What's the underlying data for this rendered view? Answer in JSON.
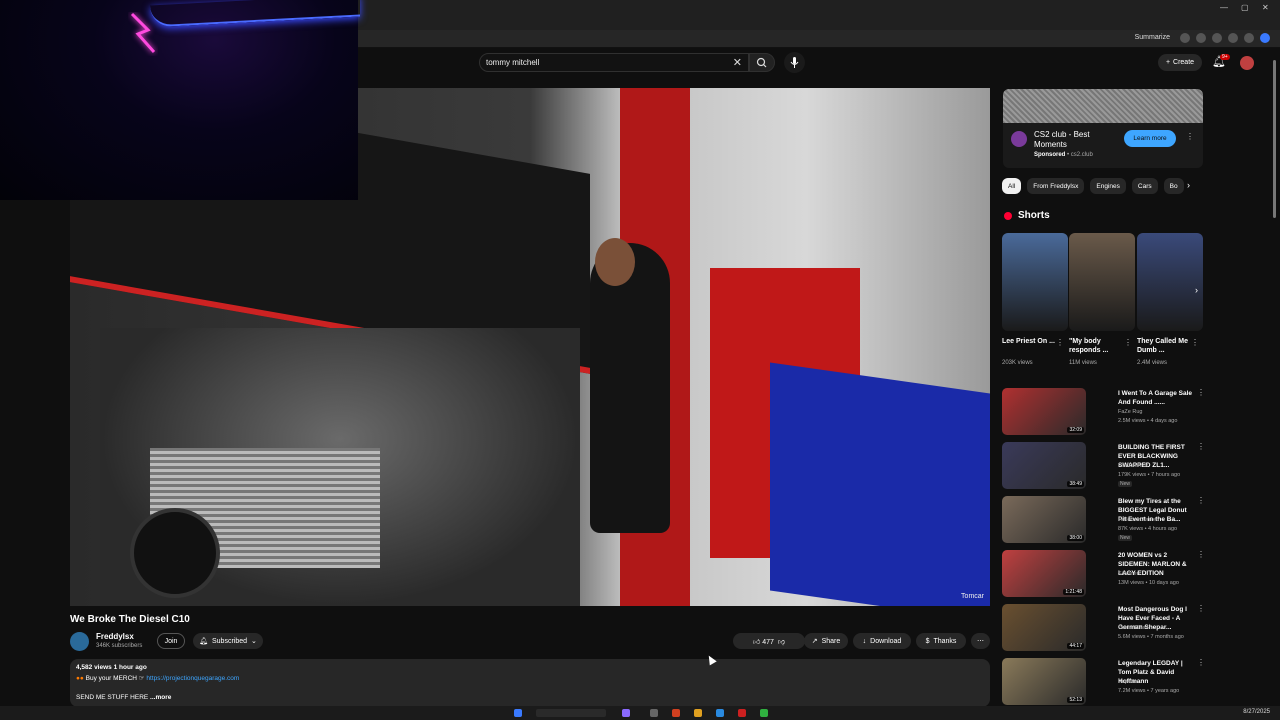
{
  "browser": {
    "toolbar_label": "Summarize",
    "date": "8/27/2025"
  },
  "search": {
    "value": "tommy mitchell"
  },
  "masthead": {
    "create_label": "Create",
    "notif_count": "9+"
  },
  "video": {
    "title": "We Broke The Diesel C10",
    "overlay_logo": "Tomcar"
  },
  "channel": {
    "name": "Freddylsx",
    "subscribers": "346K subscribers",
    "join_label": "Join",
    "subscribed_label": "Subscribed"
  },
  "actions": {
    "likes": "477",
    "share": "Share",
    "download": "Download",
    "thanks": "Thanks"
  },
  "description": {
    "meta": "4,582 views  1 hour ago",
    "merch_text": "Buy your MERCH",
    "merch_link": "https://projectionquegarage.com",
    "send_text": "SEND ME STUFF HERE",
    "more": "...more"
  },
  "ad": {
    "title": "CS2 club - Best Moments",
    "sponsored": "Sponsored",
    "domain": "cs2.club",
    "cta": "Learn more"
  },
  "chips": [
    "All",
    "From Freddylsx",
    "Engines",
    "Cars",
    "Bo"
  ],
  "shorts": {
    "title": "Shorts",
    "items": [
      {
        "title": "Lee Priest On ...",
        "views": "203K views",
        "color": "#4a6a9a"
      },
      {
        "title": "\"My body responds ...",
        "views": "11M views",
        "color": "#6a5a4a"
      },
      {
        "title": "They Called Me Dumb ...",
        "views": "2.4M views",
        "color": "#3a4a7a"
      }
    ]
  },
  "recommendations": [
    {
      "title": "I Went To A Garage Sale And Found ......",
      "channel": "FaZe Rug",
      "meta": "2.5M views • 4 days ago",
      "duration": "32:09",
      "badge": "",
      "color": "#b03030"
    },
    {
      "title": "BUILDING THE FIRST EVER BLACKWING SWAPPED ZL1...",
      "channel": "FastLifeKick",
      "meta": "179K views • 7 hours ago",
      "duration": "38:49",
      "badge": "New",
      "color": "#3a3a5a"
    },
    {
      "title": "Blew my Tires at the BIGGEST Legal Donut Pit Event in the Ba...",
      "channel": "HellooomJensen",
      "meta": "87K views • 4 hours ago",
      "duration": "38:00",
      "badge": "New",
      "color": "#7a6a5a"
    },
    {
      "title": "20 WOMEN vs 2 SIDEMEN: MARLON & LACY EDITION",
      "channel": "Sidemen",
      "meta": "13M views • 10 days ago",
      "duration": "1:21:48",
      "badge": "",
      "color": "#c04040"
    },
    {
      "title": "Most Dangerous Dog I Have Ever Faced - A German Shepar...",
      "channel": "Cesar Millan",
      "meta": "5.6M views • 7 months ago",
      "duration": "44:17",
      "badge": "",
      "color": "#6a5030"
    },
    {
      "title": "Legendary LEGDAY | Tom Platz & David Hoffmann",
      "channel": "RepOne",
      "meta": "7.2M views • 7 years ago",
      "duration": "52:13",
      "badge": "",
      "color": "#8a7a5a"
    }
  ],
  "colors": {
    "background": "#0f0f0f",
    "accent_link": "#3ea6ff",
    "brand_red": "#ff0033"
  }
}
